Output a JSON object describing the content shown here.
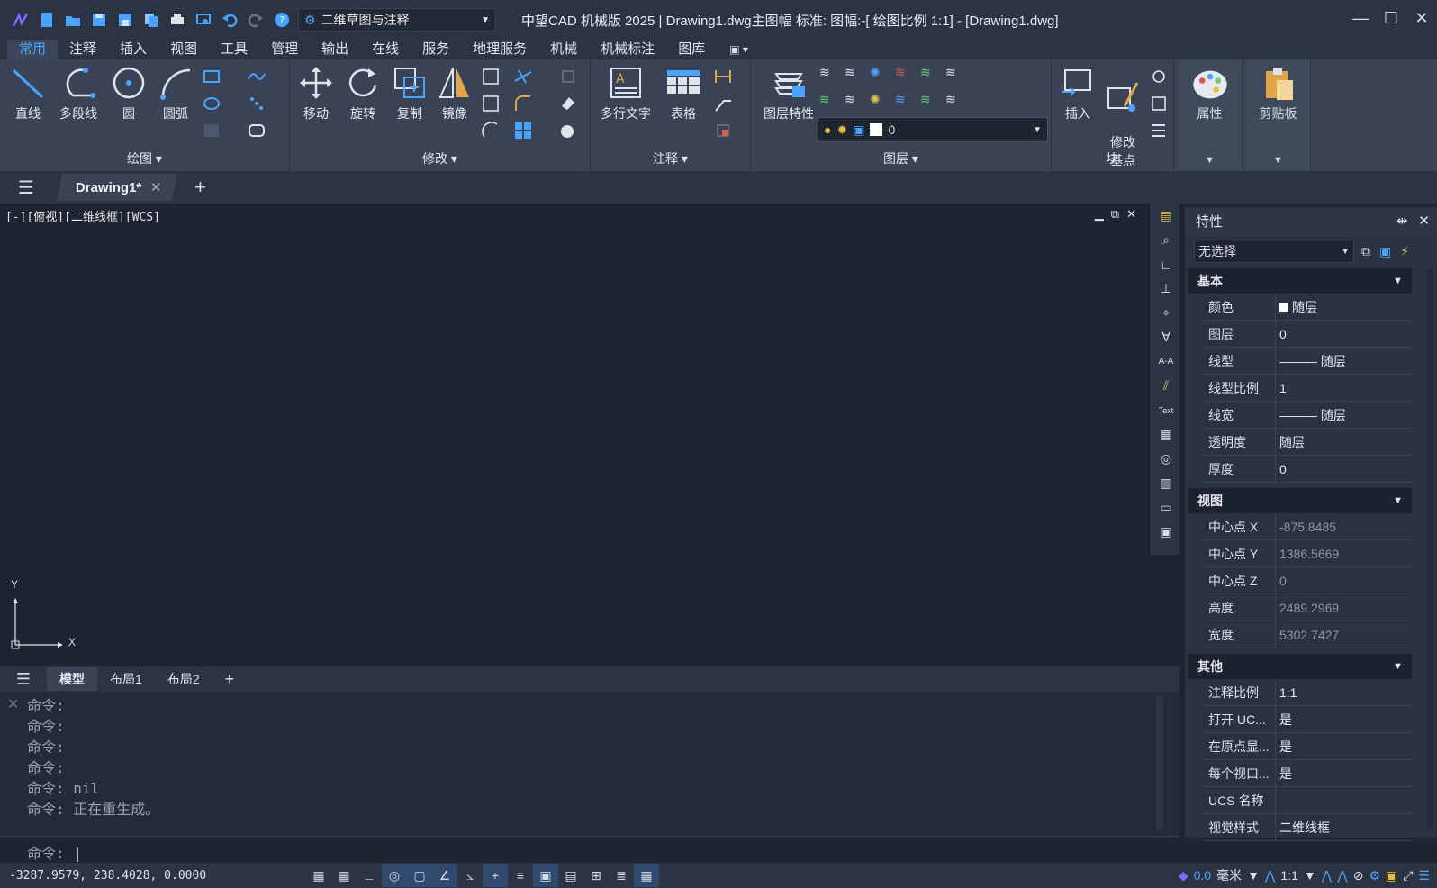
{
  "app": {
    "title": "中望CAD 机械版 2025 | Drawing1.dwg主图幅  标准: 图幅:-[ 绘图比例 1:1] - [Drawing1.dwg]",
    "workspace": "二维草图与注释"
  },
  "ribbon_tabs": [
    "常用",
    "注释",
    "插入",
    "视图",
    "工具",
    "管理",
    "输出",
    "在线",
    "服务",
    "地理服务",
    "机械",
    "机械标注",
    "图库"
  ],
  "ribbon_active": "常用",
  "panels": {
    "draw": {
      "label": "绘图",
      "tools": [
        "直线",
        "多段线",
        "圆",
        "圆弧"
      ]
    },
    "modify": {
      "label": "修改",
      "tools": [
        "移动",
        "旋转",
        "复制",
        "镜像"
      ]
    },
    "annotate": {
      "label": "注释",
      "tools": [
        "多行文字",
        "表格"
      ]
    },
    "layer": {
      "label": "图层",
      "tools": [
        "图层特性"
      ],
      "current": "0"
    },
    "block": {
      "label": "块",
      "tools": [
        "插入",
        "修改\n基点"
      ]
    },
    "props": {
      "label": "属性"
    },
    "clipboard": {
      "label": "剪贴板"
    }
  },
  "doc_tab": "Drawing1*",
  "viewport_label": "[-][俯视][二维线框][WCS]",
  "ucs": {
    "x": "X",
    "y": "Y"
  },
  "layout_tabs": [
    "模型",
    "布局1",
    "布局2"
  ],
  "layout_active": "模型",
  "command": {
    "history": [
      "命令:",
      "命令:",
      "命令:",
      "命令:",
      "命令: nil",
      "命令: 正在重生成。"
    ],
    "prompt": "命令:"
  },
  "properties": {
    "title": "特性",
    "selection": "无选择",
    "sections": [
      {
        "name": "基本",
        "rows": [
          [
            "颜色",
            "随层"
          ],
          [
            "图层",
            "0"
          ],
          [
            "线型",
            "——— 随层"
          ],
          [
            "线型比例",
            "1"
          ],
          [
            "线宽",
            "——— 随层"
          ],
          [
            "透明度",
            "随层"
          ],
          [
            "厚度",
            "0"
          ]
        ]
      },
      {
        "name": "视图",
        "rows": [
          [
            "中心点 X",
            "-875.8485"
          ],
          [
            "中心点 Y",
            "1386.5669"
          ],
          [
            "中心点 Z",
            "0"
          ],
          [
            "高度",
            "2489.2969"
          ],
          [
            "宽度",
            "5302.7427"
          ]
        ]
      },
      {
        "name": "其他",
        "rows": [
          [
            "注释比例",
            "1:1"
          ],
          [
            "打开 UC...",
            "是"
          ],
          [
            "在原点显...",
            "是"
          ],
          [
            "每个视口...",
            "是"
          ],
          [
            "UCS 名称",
            ""
          ],
          [
            "视觉样式",
            "二维线框"
          ]
        ]
      }
    ]
  },
  "status": {
    "coords": "-3287.9579, 238.4028, 0.0000",
    "unit": "毫米",
    "scale": "1:1"
  },
  "colors": {
    "accent": "#49a8ff",
    "bg": "#1f2530",
    "ribbon": "#3a4355"
  }
}
